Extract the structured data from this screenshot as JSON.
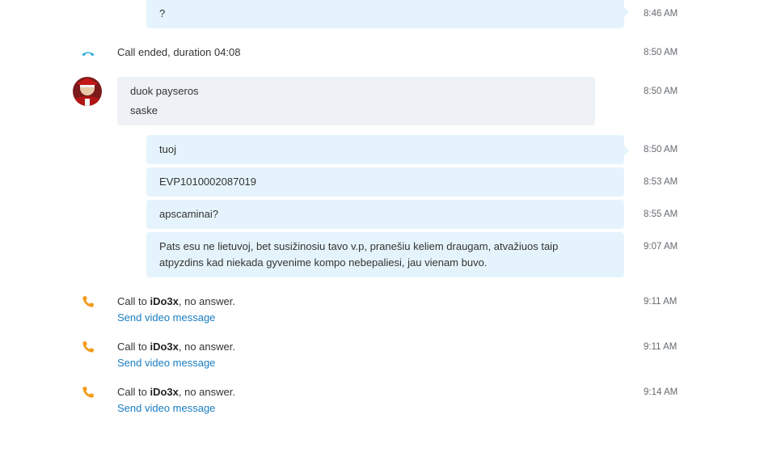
{
  "colors": {
    "outgoing_bubble": "#e5f4fc",
    "incoming_bubble": "#eef1f5",
    "link": "#1a7ec2",
    "call_ended_icon": "#1ca7d8",
    "missed_call_icon": "#f39b1b"
  },
  "messages": {
    "q": {
      "text": "?",
      "time": "8:46 AM"
    },
    "call_ended": {
      "icon": "phone-hangup-icon",
      "text": "Call ended, duration 04:08",
      "time": "8:50 AM"
    },
    "incoming": {
      "avatar": "user-avatar",
      "lines": [
        "duok payseros",
        "saske"
      ],
      "time": "8:50 AM"
    },
    "out1": {
      "text": "tuoj",
      "time": "8:50 AM"
    },
    "out2": {
      "text": "EVP1010002087019",
      "time": "8:53 AM"
    },
    "out3": {
      "text": "apscaminai?",
      "time": "8:55 AM"
    },
    "out4": {
      "lines": [
        "Pats esu ne lietuvoj, bet susižinosiu tavo v.p, pranešiu keliem draugam, atvažiuos taip",
        "atpyzdins kad niekada gyvenime kompo nebepaliesi, jau vienam buvo."
      ],
      "time": "9:07 AM"
    }
  },
  "calls": [
    {
      "icon": "phone-icon",
      "prefix": "Call to ",
      "name": "iDo3x",
      "suffix": ", no answer.",
      "link": "Send video message",
      "time": "9:11 AM"
    },
    {
      "icon": "phone-icon",
      "prefix": "Call to ",
      "name": "iDo3x",
      "suffix": ", no answer.",
      "link": "Send video message",
      "time": "9:11 AM"
    },
    {
      "icon": "phone-icon",
      "prefix": "Call to ",
      "name": "iDo3x",
      "suffix": ", no answer.",
      "link": "Send video message",
      "time": "9:14 AM"
    }
  ]
}
